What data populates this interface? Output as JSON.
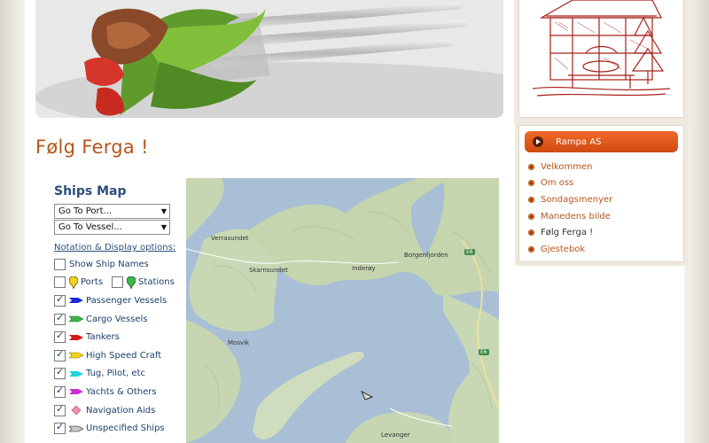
{
  "page": {
    "title": "Følg Ferga !"
  },
  "ships_panel": {
    "title": "Ships Map",
    "port_select": "Go To Port...",
    "vessel_select": "Go To Vessel...",
    "notation_link": "Notation & Display options:",
    "options": [
      {
        "label": "Show Ship Names",
        "checked": false,
        "icon": "none"
      },
      {
        "label": "Ports",
        "checked": false,
        "icon": "yellow-pin-icon"
      },
      {
        "label": "Stations",
        "checked": false,
        "icon": "green-pin-icon"
      },
      {
        "label": "Passenger Vessels",
        "checked": true,
        "icon": "blue-arrow-icon",
        "color": "#1a2ad6"
      },
      {
        "label": "Cargo Vessels",
        "checked": true,
        "icon": "green-arrow-icon",
        "color": "#3bb84a"
      },
      {
        "label": "Tankers",
        "checked": true,
        "icon": "red-arrow-icon",
        "color": "#d11a1a"
      },
      {
        "label": "High Speed Craft",
        "checked": true,
        "icon": "yellow-arrow-icon",
        "color": "#f2d21a"
      },
      {
        "label": "Tug, Pilot, etc",
        "checked": true,
        "icon": "cyan-arrow-icon",
        "color": "#22d3e0"
      },
      {
        "label": "Yachts & Others",
        "checked": true,
        "icon": "magenta-arrow-icon",
        "color": "#d12ad6"
      },
      {
        "label": "Navigation Aids",
        "checked": true,
        "icon": "pink-diamond-icon",
        "color": "#f08cb0"
      },
      {
        "label": "Unspecified Ships",
        "checked": true,
        "icon": "gray-arrow-icon",
        "color": "#9a9a9a"
      }
    ]
  },
  "map": {
    "labels": {
      "verrasundet": "Verrasundet",
      "skarnsundet": "Skarnsundet",
      "inderoy": "Inderøy",
      "borgenfjorden": "Borgenfjorden",
      "mosvik": "Mosvik",
      "levanger": "Levanger",
      "e6_top": "E6",
      "e6_bottom": "E6"
    }
  },
  "sidebar": {
    "header": "Rampa AS",
    "items": [
      {
        "label": "Velkommen"
      },
      {
        "label": "Om oss"
      },
      {
        "label": "Sondagsmenyer"
      },
      {
        "label": "Manedens bilde"
      },
      {
        "label": "Følg Ferga !"
      },
      {
        "label": "Gjestebok"
      }
    ]
  },
  "colors": {
    "accent": "#b5561b",
    "header_orange": "#e85c1e",
    "link_blue": "#2a4f7e",
    "water": "#a9bfd5"
  }
}
